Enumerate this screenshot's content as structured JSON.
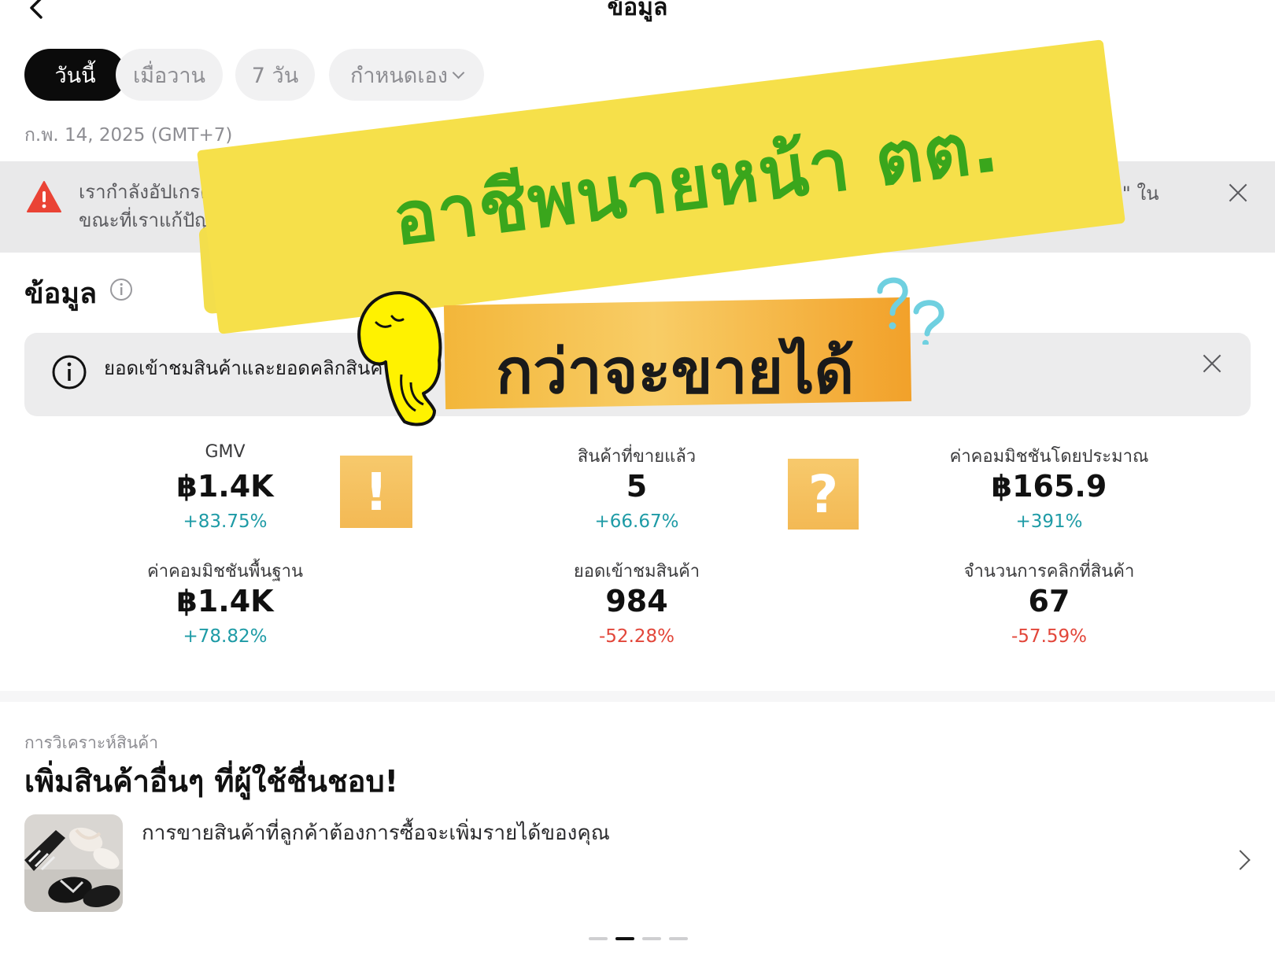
{
  "header": {
    "title": "ข้อมูล"
  },
  "filters": {
    "chips": [
      {
        "label": "วันนี้",
        "active": true
      },
      {
        "label": "เมื่อวาน",
        "active": false
      },
      {
        "label": "7 วัน",
        "active": false
      },
      {
        "label": "กำหนดเอง",
        "active": false
      }
    ],
    "date_label": "ก.พ. 14, 2025 (GMT+7)"
  },
  "warning": {
    "line1": "เรากำลังอัปเกรดระบ",
    "line2": "ขณะที่เราแก้ปัญหานี้",
    "tail": "...ลิเอต\" ใน"
  },
  "section": {
    "title": "ข้อมูล"
  },
  "notice": {
    "text": "ยอดเข้าชมสินค้าและยอดคลิกสินค้"
  },
  "metrics": [
    {
      "label": "GMV",
      "value": "฿1.4K",
      "change": "+83.75%",
      "trend": "up"
    },
    {
      "label": "สินค้าที่ขายแล้ว",
      "value": "5",
      "change": "+66.67%",
      "trend": "up"
    },
    {
      "label": "ค่าคอมมิชชันโดยประมาณ",
      "value": "฿165.9",
      "change": "+391%",
      "trend": "up"
    },
    {
      "label": "ค่าคอมมิชชันพื้นฐาน",
      "value": "฿1.4K",
      "change": "+78.82%",
      "trend": "up"
    },
    {
      "label": "ยอดเข้าชมสินค้า",
      "value": "984",
      "change": "-52.28%",
      "trend": "down"
    },
    {
      "label": "จำนวนการคลิกที่สินค้า",
      "value": "67",
      "change": "-57.59%",
      "trend": "down"
    }
  ],
  "product_analysis": {
    "label": "การวิเคราะห์สินค้า",
    "title": "เพิ่มสินค้าอื่นๆ ที่ผู้ใช้ชื่นชอบ!",
    "description": "การขายสินค้าที่ลูกค้าต้องการซื้อจะเพิ่มรายได้ของคุณ",
    "pager": {
      "count": 4,
      "active": 1
    }
  },
  "overlay": {
    "headline": "อาชีพนายหน้า ตต.",
    "subheadline": "กว่าจะขายได้",
    "tile_left": "!",
    "tile_right": "?",
    "colors": {
      "headline": "#3aa61c",
      "yellow_banner": "#f6e04a",
      "orange_banner": "#f3b63a"
    }
  },
  "colors": {
    "positive": "#1e9ba6",
    "negative": "#e2463a",
    "chip_active": "#0b0b0b"
  }
}
